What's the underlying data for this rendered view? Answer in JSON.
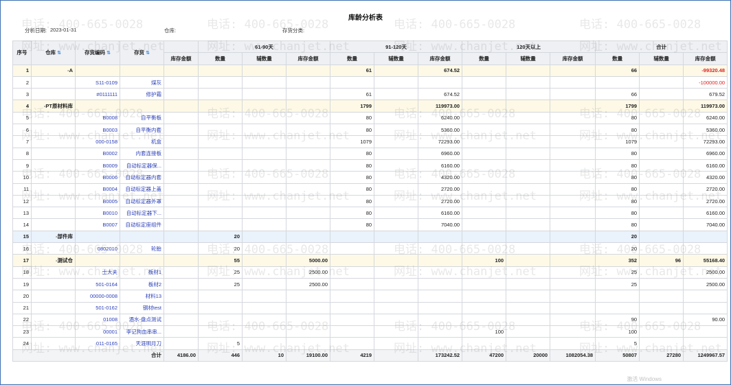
{
  "title": "库龄分析表",
  "filters": {
    "date_label": "分析日期:",
    "date_value": "2023-01-31",
    "warehouse_label": "仓库:",
    "category_label": "存货分类:"
  },
  "headers": {
    "seq": "序号",
    "warehouse": "仓库",
    "code": "存货编码",
    "name": "存货",
    "amount_first": "库存金额",
    "groups": [
      "61-90天",
      "91-120天",
      "120天以上",
      "合计"
    ],
    "sub": [
      "数量",
      "辅数量",
      "库存金额"
    ]
  },
  "rows": [
    {
      "seq": "1",
      "wh": "A",
      "code": "",
      "name": "",
      "c": [
        "",
        "",
        "",
        "",
        "61",
        "",
        "674.52",
        "",
        "",
        "",
        "66",
        "",
        "-99320.48"
      ],
      "type": "grp"
    },
    {
      "seq": "2",
      "wh": "",
      "code": "S11-0109",
      "name": "煤灰",
      "c": [
        "",
        "",
        "",
        "",
        "",
        "",
        "",
        "",
        "",
        "",
        "",
        "",
        "-100000.00"
      ],
      "type": ""
    },
    {
      "seq": "3",
      "wh": "",
      "code": "#0111111",
      "name": "修护霜",
      "c": [
        "",
        "",
        "",
        "",
        "61",
        "",
        "674.52",
        "",
        "",
        "",
        "66",
        "",
        "679.52"
      ],
      "type": ""
    },
    {
      "seq": "4",
      "wh": "PT原材料库",
      "code": "",
      "name": "",
      "c": [
        "",
        "",
        "",
        "",
        "1799",
        "",
        "119973.00",
        "",
        "",
        "",
        "1799",
        "",
        "119973.00"
      ],
      "type": "grp"
    },
    {
      "seq": "5",
      "wh": "",
      "code": "B0008",
      "name": "自平衡板",
      "c": [
        "",
        "",
        "",
        "",
        "80",
        "",
        "6240.00",
        "",
        "",
        "",
        "80",
        "",
        "6240.00"
      ],
      "type": ""
    },
    {
      "seq": "6",
      "wh": "",
      "code": "B0003",
      "name": "自平衡内套",
      "c": [
        "",
        "",
        "",
        "",
        "80",
        "",
        "5360.00",
        "",
        "",
        "",
        "80",
        "",
        "5360.00"
      ],
      "type": ""
    },
    {
      "seq": "7",
      "wh": "",
      "code": "000-0158",
      "name": "机盒",
      "c": [
        "",
        "",
        "",
        "",
        "1079",
        "",
        "72293.00",
        "",
        "",
        "",
        "1079",
        "",
        "72293.00"
      ],
      "type": ""
    },
    {
      "seq": "8",
      "wh": "",
      "code": "B0002",
      "name": "内套连接板",
      "c": [
        "",
        "",
        "",
        "",
        "80",
        "",
        "6960.00",
        "",
        "",
        "",
        "80",
        "",
        "6960.00"
      ],
      "type": ""
    },
    {
      "seq": "9",
      "wh": "",
      "code": "B0009",
      "name": "自动标定器保...",
      "c": [
        "",
        "",
        "",
        "",
        "80",
        "",
        "6160.00",
        "",
        "",
        "",
        "80",
        "",
        "6160.00"
      ],
      "type": ""
    },
    {
      "seq": "10",
      "wh": "",
      "code": "B0006",
      "name": "自动标定器内套",
      "c": [
        "",
        "",
        "",
        "",
        "80",
        "",
        "4320.00",
        "",
        "",
        "",
        "80",
        "",
        "4320.00"
      ],
      "type": ""
    },
    {
      "seq": "11",
      "wh": "",
      "code": "B0004",
      "name": "自动标定器上盖",
      "c": [
        "",
        "",
        "",
        "",
        "80",
        "",
        "2720.00",
        "",
        "",
        "",
        "80",
        "",
        "2720.00"
      ],
      "type": ""
    },
    {
      "seq": "12",
      "wh": "",
      "code": "B0005",
      "name": "自动标定器外罩",
      "c": [
        "",
        "",
        "",
        "",
        "80",
        "",
        "2720.00",
        "",
        "",
        "",
        "80",
        "",
        "2720.00"
      ],
      "type": ""
    },
    {
      "seq": "13",
      "wh": "",
      "code": "B0010",
      "name": "自动标定器下...",
      "c": [
        "",
        "",
        "",
        "",
        "80",
        "",
        "6160.00",
        "",
        "",
        "",
        "80",
        "",
        "6160.00"
      ],
      "type": ""
    },
    {
      "seq": "14",
      "wh": "",
      "code": "B0007",
      "name": "自动标定座组件",
      "c": [
        "",
        "",
        "",
        "",
        "80",
        "",
        "7040.00",
        "",
        "",
        "",
        "80",
        "",
        "7040.00"
      ],
      "type": ""
    },
    {
      "seq": "15",
      "wh": "部件库",
      "code": "",
      "name": "",
      "c": [
        "",
        "20",
        "",
        "",
        "",
        "",
        "",
        "",
        "",
        "",
        "20",
        "",
        ""
      ],
      "type": "grp-blue"
    },
    {
      "seq": "16",
      "wh": "",
      "code": "0802010",
      "name": "轮胎",
      "c": [
        "",
        "20",
        "",
        "",
        "",
        "",
        "",
        "",
        "",
        "",
        "20",
        "",
        ""
      ],
      "type": ""
    },
    {
      "seq": "17",
      "wh": "测试仓",
      "code": "",
      "name": "",
      "c": [
        "",
        "55",
        "",
        "5000.00",
        "",
        "",
        "",
        "100",
        "",
        "",
        "352",
        "96",
        "55168.40"
      ],
      "type": "grp"
    },
    {
      "seq": "18",
      "wh": "",
      "code": "士大夫",
      "name": "板材1",
      "c": [
        "",
        "25",
        "",
        "2500.00",
        "",
        "",
        "",
        "",
        "",
        "",
        "25",
        "",
        "2500.00"
      ],
      "type": ""
    },
    {
      "seq": "19",
      "wh": "",
      "code": "501-0164",
      "name": "板材2",
      "c": [
        "",
        "25",
        "",
        "2500.00",
        "",
        "",
        "",
        "",
        "",
        "",
        "25",
        "",
        "2500.00"
      ],
      "type": ""
    },
    {
      "seq": "20",
      "wh": "",
      "code": "00000-0008",
      "name": "材料13",
      "c": [
        "",
        "",
        "",
        "",
        "",
        "",
        "",
        "",
        "",
        "",
        "",
        "",
        ""
      ],
      "type": ""
    },
    {
      "seq": "21",
      "wh": "",
      "code": "501-0162",
      "name": "钢材test",
      "c": [
        "",
        "",
        "",
        "",
        "",
        "",
        "",
        "",
        "",
        "",
        "",
        "",
        ""
      ],
      "type": ""
    },
    {
      "seq": "22",
      "wh": "",
      "code": "01008",
      "name": "酒水-盘点测试",
      "c": [
        "",
        "",
        "",
        "",
        "",
        "",
        "",
        "",
        "",
        "",
        "90",
        "",
        "90.00"
      ],
      "type": ""
    },
    {
      "seq": "23",
      "wh": "",
      "code": "00001",
      "name": "李记狗血串串...",
      "c": [
        "",
        "",
        "",
        "",
        "",
        "",
        "",
        "100",
        "",
        "",
        "100",
        "",
        ""
      ],
      "type": ""
    },
    {
      "seq": "24",
      "wh": "",
      "code": "011-0165",
      "name": "天涯明月刀",
      "c": [
        "",
        "5",
        "",
        "",
        "",
        "",
        "",
        "",
        "",
        "",
        "5",
        "",
        ""
      ],
      "type": ""
    }
  ],
  "total": {
    "label": "合计",
    "c": [
      "4186.00",
      "446",
      "10",
      "19100.00",
      "4219",
      "",
      "173242.52",
      "47200",
      "20000",
      "1082054.38",
      "50807",
      "27280",
      "1249967.57"
    ]
  },
  "watermark": {
    "phone": "电话: 400-665-0028",
    "site": "网址: www.chanjet.net"
  },
  "corner_text": "激活 Windows"
}
